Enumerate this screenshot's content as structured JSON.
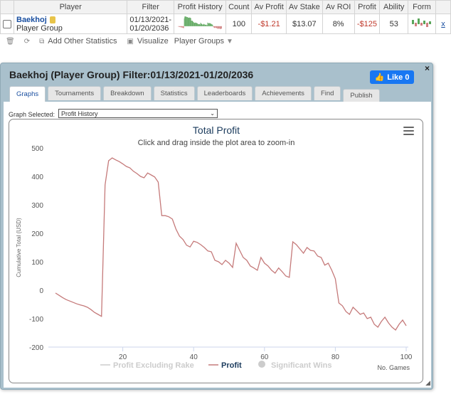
{
  "table": {
    "headers": [
      "Player",
      "Filter",
      "Profit History",
      "Count",
      "Av Profit",
      "Av Stake",
      "Av ROI",
      "Profit",
      "Ability",
      "Form"
    ],
    "row": {
      "player_name": "Baekhoj",
      "player_group": "Player Group",
      "filter_line1": "01/13/2021-",
      "filter_line2": "01/20/2036",
      "count": "100",
      "av_profit": "-$1.21",
      "av_stake": "$13.07",
      "av_roi": "8%",
      "profit": "-$125",
      "ability": "53",
      "close": "x"
    }
  },
  "toolbar": {
    "add_stats": "Add Other Statistics",
    "visualize": "Visualize",
    "player_groups": "Player Groups"
  },
  "dialog": {
    "title": "Baekhoj (Player Group) Filter:01/13/2021-01/20/2036",
    "like_label": "Like 0",
    "close": "×",
    "tabs": [
      "Graphs",
      "Tournaments",
      "Breakdown",
      "Statistics",
      "Leaderboards",
      "Achievements",
      "Find",
      "Publish"
    ],
    "graph_selected_label": "Graph Selected:",
    "graph_selected_value": "Profit History"
  },
  "colors": {
    "profit_line": "#c57a7a",
    "title_blue": "#1a3a5c",
    "dialog_bg": "#a9c0cc",
    "like_blue": "#1877f2"
  },
  "chart_data": {
    "type": "line",
    "title": "Total Profit",
    "subtitle": "Click and drag inside the plot area to zoom-in",
    "ylabel": "Cumulative Total (USD)",
    "xlabel": "No. Games",
    "ylim": [
      -200,
      500
    ],
    "xlim": [
      1,
      100
    ],
    "y_ticks": [
      500,
      400,
      300,
      200,
      100,
      0,
      -100,
      -200
    ],
    "x_ticks": [
      20,
      40,
      60,
      80,
      100
    ],
    "grid": false,
    "legend_position": "bottom",
    "legend": [
      {
        "name": "Profit Excluding Rake",
        "visible": false
      },
      {
        "name": "Profit",
        "visible": true
      },
      {
        "name": "Significant Wins",
        "visible": false
      }
    ],
    "series": [
      {
        "name": "Profit",
        "x": [
          1,
          2,
          3,
          4,
          5,
          6,
          7,
          8,
          9,
          10,
          11,
          12,
          13,
          14,
          15,
          16,
          17,
          18,
          19,
          20,
          21,
          22,
          23,
          24,
          25,
          26,
          27,
          28,
          29,
          30,
          31,
          32,
          33,
          34,
          35,
          36,
          37,
          38,
          39,
          40,
          41,
          42,
          43,
          44,
          45,
          46,
          47,
          48,
          49,
          50,
          51,
          52,
          53,
          54,
          55,
          56,
          57,
          58,
          59,
          60,
          61,
          62,
          63,
          64,
          65,
          66,
          67,
          68,
          69,
          70,
          71,
          72,
          73,
          74,
          75,
          76,
          77,
          78,
          79,
          80,
          81,
          82,
          83,
          84,
          85,
          86,
          87,
          88,
          89,
          90,
          91,
          92,
          93,
          94,
          95,
          96,
          97,
          98,
          99,
          100
        ],
        "values": [
          -10,
          -18,
          -26,
          -33,
          -38,
          -43,
          -48,
          -52,
          -55,
          -60,
          -68,
          -78,
          -85,
          -92,
          370,
          455,
          465,
          458,
          452,
          444,
          435,
          430,
          418,
          410,
          400,
          395,
          412,
          405,
          398,
          380,
          262,
          262,
          258,
          250,
          215,
          190,
          178,
          158,
          152,
          172,
          168,
          160,
          150,
          138,
          135,
          105,
          100,
          90,
          105,
          95,
          80,
          165,
          140,
          115,
          105,
          85,
          78,
          70,
          115,
          95,
          85,
          70,
          60,
          78,
          65,
          50,
          45,
          170,
          160,
          145,
          130,
          150,
          140,
          138,
          120,
          115,
          88,
          95,
          70,
          40,
          -45,
          -55,
          -75,
          -85,
          -60,
          -72,
          -85,
          -80,
          -100,
          -95,
          -120,
          -130,
          -110,
          -95,
          -115,
          -130,
          -140,
          -120,
          -105,
          -125
        ]
      }
    ]
  }
}
